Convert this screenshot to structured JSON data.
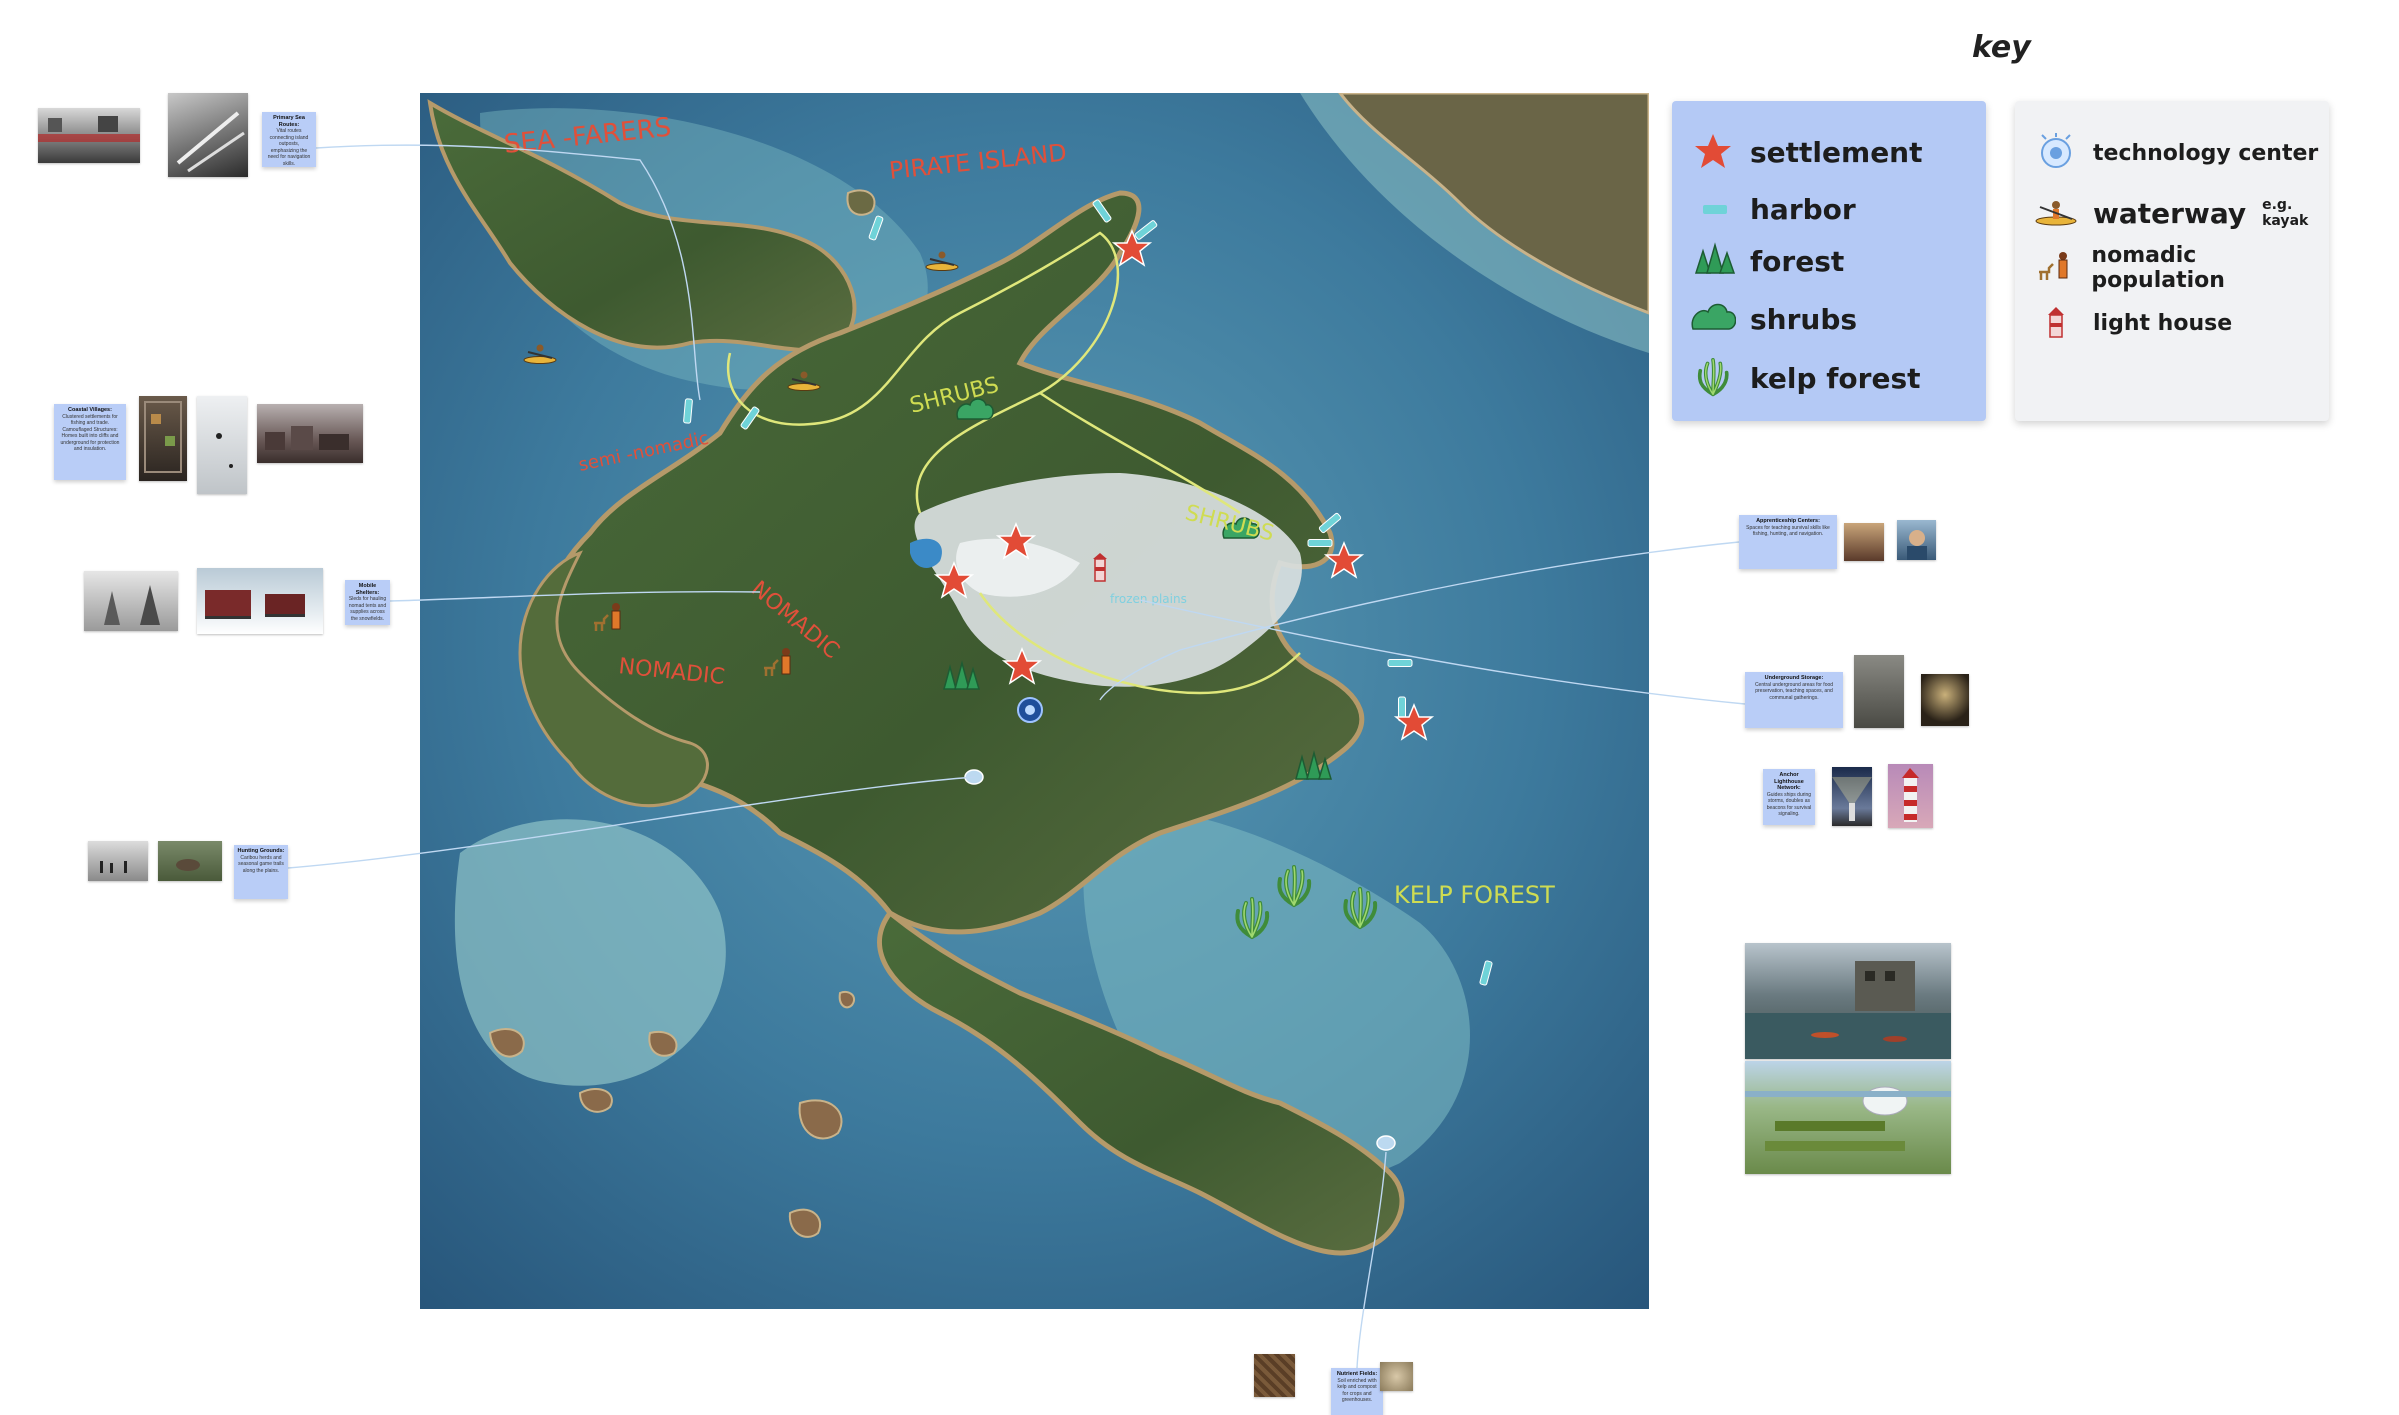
{
  "key": {
    "title": "key",
    "items_left": [
      {
        "icon": "star-icon",
        "label": "settlement"
      },
      {
        "icon": "harbor-dash-icon",
        "label": "harbor"
      },
      {
        "icon": "pine-trees-icon",
        "label": "forest"
      },
      {
        "icon": "shrub-icon",
        "label": "shrubs"
      },
      {
        "icon": "kelp-icon",
        "label": "kelp forest"
      }
    ],
    "items_right": [
      {
        "icon": "technology-center-icon",
        "label": "technology center",
        "note": ""
      },
      {
        "icon": "kayaker-icon",
        "label": "waterway",
        "note": "e.g. kayak"
      },
      {
        "icon": "nomad-with-animal-icon",
        "label": "nomadic population",
        "note": ""
      },
      {
        "icon": "lighthouse-icon",
        "label": "light house",
        "note": ""
      }
    ]
  },
  "map_labels": {
    "sea_farers": "SEA -FARERS",
    "pirate_island": "PIRATE ISLAND",
    "shrubs_1": "SHRUBS",
    "shrubs_2": "SHRUBS",
    "semi_nomadic": "semi -nomadic",
    "nomadic_1": "NOMADIC",
    "nomadic_2": "NOMADIC",
    "kelp_forest": "KELP FOREST",
    "frozen_region": "frozen plains"
  },
  "sticky_notes": [
    {
      "id": "primary-sea-routes",
      "title": "Primary Sea Routes:",
      "body": "Vital routes connecting island outposts, emphasizing the need for navigation skills."
    },
    {
      "id": "coastal-villages",
      "title": "Coastal Villages:",
      "body": "Clustered settlements for fishing and trade. Camouflaged Structures: Homes built into cliffs and underground for protection and insulation."
    },
    {
      "id": "nomad-shelters",
      "title": "Mobile Shelters:",
      "body": "Sleds for hauling nomad tents and supplies across the snowfields."
    },
    {
      "id": "hunting-grounds",
      "title": "Hunting Grounds:",
      "body": "Caribou herds and seasonal game trails along the plains."
    },
    {
      "id": "apprenticeship-centers",
      "title": "Apprenticeship Centers:",
      "body": "Spaces for teaching survival skills like fishing, hunting, and navigation."
    },
    {
      "id": "underground-storage",
      "title": "Underground Storage:",
      "body": "Central underground areas for food preservation, teaching spaces, and communal gatherings."
    },
    {
      "id": "lighthouse-network",
      "title": "Anchor Lighthouse Network:",
      "body": "Guides ships during storms, doubles as beacons for survival signaling."
    },
    {
      "id": "nutrient-fields",
      "title": "Nutrient Fields:",
      "body": "Soil enriched with kelp and compost for crops and greenhouses."
    }
  ]
}
